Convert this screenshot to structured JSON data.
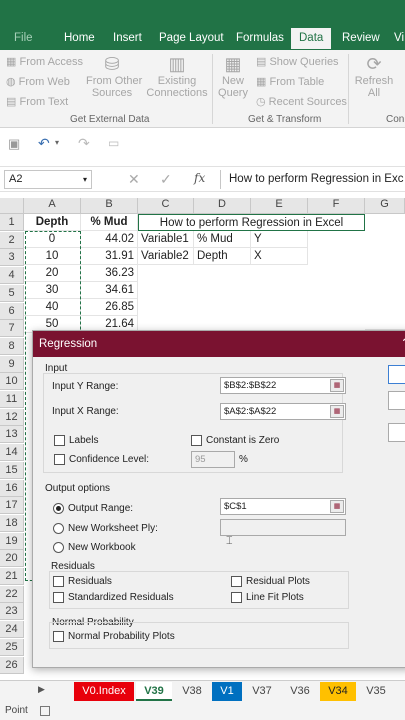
{
  "ribbon": {
    "tabs": [
      "File",
      "Home",
      "Insert",
      "Page Layout",
      "Formulas",
      "Data",
      "Review",
      "Vi"
    ],
    "active_tab": "Data",
    "get_external": {
      "from_access": "From Access",
      "from_web": "From Web",
      "from_text": "From Text",
      "from_other_1": "From Other",
      "from_other_2": "Sources",
      "existing_1": "Existing",
      "existing_2": "Connections",
      "group": "Get External Data"
    },
    "transform": {
      "new_query_1": "New",
      "new_query_2": "Query",
      "show_queries": "Show Queries",
      "from_table": "From Table",
      "recent_sources": "Recent Sources",
      "group": "Get & Transform"
    },
    "connections": {
      "refresh_1": "Refresh",
      "refresh_2": "All",
      "group": "Conn"
    }
  },
  "formula_bar": {
    "name_box": "A2",
    "fx": "fx",
    "content": "How to perform Regression in Exc"
  },
  "grid": {
    "columns": [
      "A",
      "B",
      "C",
      "D",
      "E",
      "F",
      "G"
    ],
    "rows": [
      "1",
      "2",
      "3",
      "4",
      "5",
      "6",
      "7",
      "8",
      "9",
      "10",
      "11",
      "12",
      "13",
      "14",
      "15",
      "16",
      "17",
      "18",
      "19",
      "20",
      "21",
      "22",
      "23",
      "24",
      "25",
      "26"
    ],
    "r1": {
      "a": "Depth",
      "b": "% Mud",
      "title": "How to perform Regression in Excel"
    },
    "r2": {
      "a": "0",
      "b": "44.02",
      "c": "Variable1",
      "d": "% Mud",
      "e": "Y"
    },
    "r3": {
      "a": "10",
      "b": "31.91",
      "c": "Variable2",
      "d": "Depth",
      "e": "X"
    },
    "r4": {
      "a": "20",
      "b": "36.23"
    },
    "r5": {
      "a": "30",
      "b": "34.61"
    },
    "r6": {
      "a": "40",
      "b": "26.85"
    },
    "r7": {
      "a": "50",
      "b": "21.64"
    }
  },
  "dialog": {
    "title": "Regression",
    "input_section": "Input",
    "input_y_label": "Input Y Range:",
    "input_y_value": "$B$2:$B$22",
    "input_x_label": "Input X Range:",
    "input_x_value": "$A$2:$A$22",
    "labels": "Labels",
    "constant_zero": "Constant is Zero",
    "confidence": "Confidence Level:",
    "confidence_value": "95",
    "percent": "%",
    "output_section": "Output options",
    "output_range": "Output Range:",
    "output_range_value": "$C$1",
    "new_ws": "New Worksheet Ply:",
    "new_wb": "New Workbook",
    "residuals_section": "Residuals",
    "residuals": "Residuals",
    "std_residuals": "Standardized Residuals",
    "residual_plots": "Residual Plots",
    "line_fit": "Line Fit Plots",
    "normal_section": "Normal Probability",
    "normal_plots": "Normal Probability Plots"
  },
  "sheet_tabs": [
    {
      "label": "V0.Index",
      "color": "#e8000b",
      "text": "#ffffff"
    },
    {
      "label": "V39",
      "color": "#ffffff",
      "text": "#217346"
    },
    {
      "label": "V38",
      "color": "#f3f3f3",
      "text": "#444444"
    },
    {
      "label": "V1",
      "color": "#0070c0",
      "text": "#ffffff"
    },
    {
      "label": "V37",
      "color": "#f3f3f3",
      "text": "#444444"
    },
    {
      "label": "V36",
      "color": "#f3f3f3",
      "text": "#444444"
    },
    {
      "label": "V34",
      "color": "#ffc000",
      "text": "#222222"
    },
    {
      "label": "V35",
      "color": "#f3f3f3",
      "text": "#444444"
    }
  ],
  "status": {
    "mode": "Point"
  },
  "colors": {
    "accent": "#217346",
    "dialog_title": "#7a1230"
  }
}
